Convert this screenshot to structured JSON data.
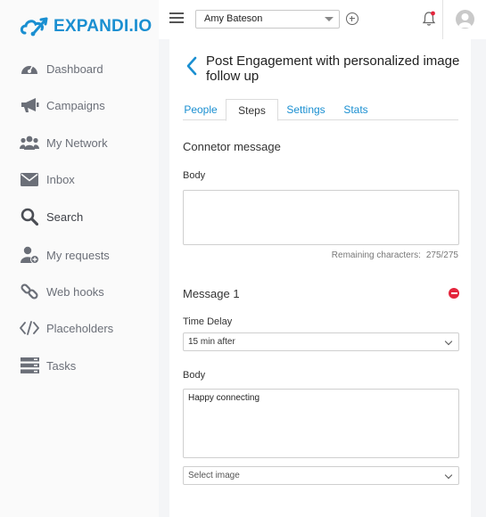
{
  "brand": {
    "name": "EXPANDI.IO",
    "color": "#1a8fd1"
  },
  "sidebar": {
    "items": [
      {
        "label": "Dashboard",
        "icon": "dashboard-gauge-icon"
      },
      {
        "label": "Campaigns",
        "icon": "megaphone-icon"
      },
      {
        "label": "My Network",
        "icon": "users-group-icon"
      },
      {
        "label": "Inbox",
        "icon": "envelope-icon"
      },
      {
        "label": "Search",
        "icon": "search-icon"
      },
      {
        "label": "My requests",
        "icon": "user-plus-icon"
      },
      {
        "label": "Web hooks",
        "icon": "link-icon"
      },
      {
        "label": "Placeholders",
        "icon": "code-icon"
      },
      {
        "label": "Tasks",
        "icon": "server-list-icon"
      }
    ]
  },
  "topbar": {
    "account": "Amy Bateson",
    "icons": [
      "hamburger-menu-icon",
      "add-circle-icon",
      "notification-bell-icon",
      "user-avatar-icon"
    ]
  },
  "page": {
    "title": "Post Engagement with personalized image follow up",
    "tabs": [
      "People",
      "Steps",
      "Settings",
      "Stats"
    ],
    "active_tab": "Steps"
  },
  "connector": {
    "title": "Connetor message",
    "body_label": "Body",
    "body_value": "",
    "remaining_label": "Remaining characters:",
    "remaining_value": "275/275"
  },
  "message1": {
    "title": "Message 1",
    "time_delay_label": "Time Delay",
    "time_delay_value": "15 min after",
    "body_label": "Body",
    "body_value": "Happy connecting",
    "image_placeholder": "Select image"
  },
  "colors": {
    "accent": "#1a8fd1",
    "danger": "#e4253c",
    "sidebar_text": "#6b6f78"
  }
}
